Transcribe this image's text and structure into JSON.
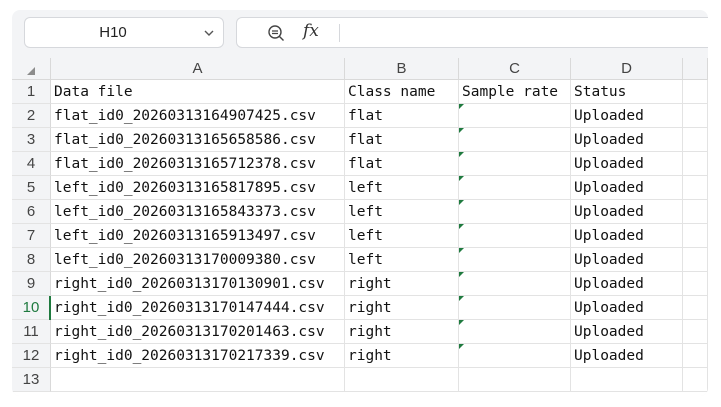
{
  "formula_bar": {
    "name_box": "H10",
    "fx_label": "fx",
    "formula_value": ""
  },
  "columns": [
    "A",
    "B",
    "C",
    "D"
  ],
  "rows": [
    {
      "num": "1",
      "cells": [
        "Data file",
        "Class name",
        "Sample rate",
        "Status"
      ]
    },
    {
      "num": "2",
      "cells": [
        "flat_id0_20260313164907425.csv",
        "flat",
        "",
        "Uploaded"
      ]
    },
    {
      "num": "3",
      "cells": [
        "flat_id0_20260313165658586.csv",
        "flat",
        "",
        "Uploaded"
      ]
    },
    {
      "num": "4",
      "cells": [
        "flat_id0_20260313165712378.csv",
        "flat",
        "",
        "Uploaded"
      ]
    },
    {
      "num": "5",
      "cells": [
        "left_id0_20260313165817895.csv",
        "left",
        "",
        "Uploaded"
      ]
    },
    {
      "num": "6",
      "cells": [
        "left_id0_20260313165843373.csv",
        "left",
        "",
        "Uploaded"
      ]
    },
    {
      "num": "7",
      "cells": [
        "left_id0_20260313165913497.csv",
        "left",
        "",
        "Uploaded"
      ]
    },
    {
      "num": "8",
      "cells": [
        "left_id0_20260313170009380.csv",
        "left",
        "",
        "Uploaded"
      ]
    },
    {
      "num": "9",
      "cells": [
        "right_id0_20260313170130901.csv",
        "right",
        "",
        "Uploaded"
      ]
    },
    {
      "num": "10",
      "cells": [
        "right_id0_20260313170147444.csv",
        "right",
        "",
        "Uploaded"
      ]
    },
    {
      "num": "11",
      "cells": [
        "right_id0_20260313170201463.csv",
        "right",
        "",
        "Uploaded"
      ]
    },
    {
      "num": "12",
      "cells": [
        "right_id0_20260313170217339.csv",
        "right",
        "",
        "Uploaded"
      ]
    },
    {
      "num": "13",
      "cells": [
        "",
        "",
        "",
        ""
      ]
    }
  ],
  "active_row": "10",
  "colors": {
    "accent": "#1f7a3f",
    "header_bg": "#f3f4f6",
    "grid_line": "#e3e3e3"
  },
  "icons": {
    "zoom": "zoom-formula-icon",
    "dropdown": "chevron-down-icon"
  }
}
